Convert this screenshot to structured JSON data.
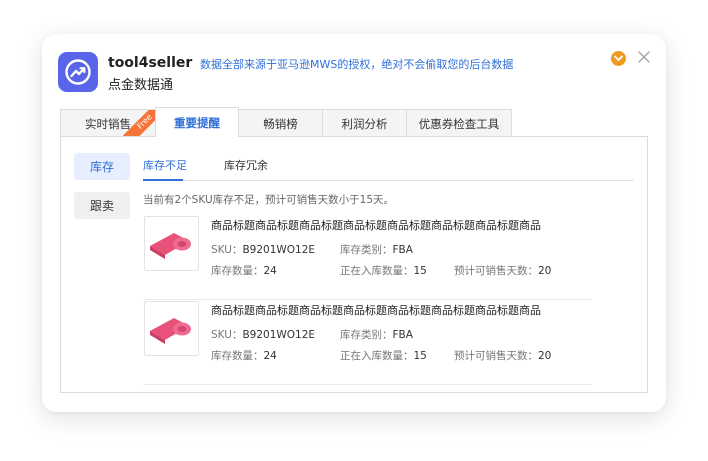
{
  "header": {
    "app_name": "tool4seller",
    "app_subtitle": "点金数据通",
    "notice": "数据全部来源于亚马逊MWS的授权，绝对不会偷取您的后台数据",
    "notify_icon": "notify-icon",
    "close_icon": "close-icon"
  },
  "tabs": [
    {
      "label": "实时销售",
      "badge": "Free"
    },
    {
      "label": "重要提醒",
      "active": true
    },
    {
      "label": "畅销榜"
    },
    {
      "label": "利润分析"
    },
    {
      "label": "优惠券检查工具"
    }
  ],
  "sidebar": {
    "items": [
      {
        "label": "库存",
        "active": true
      },
      {
        "label": "跟卖"
      }
    ]
  },
  "subtabs": [
    {
      "label": "库存不足",
      "active": true
    },
    {
      "label": "库存冗余"
    }
  ],
  "summary": "当前有2个SKU库存不足，预计可销售天数小于15天。",
  "items": [
    {
      "title": "商品标题商品标题商品标题商品标题商品标题商品标题商品标题商品",
      "sku_label": "SKU：",
      "sku": "B9201WO12E",
      "type_label": "库存类别：",
      "type": "FBA",
      "stock_label": "库存数量：",
      "stock": "24",
      "inbound_label": "正在入库数量：",
      "inbound": "15",
      "days_label": "预计可销售天数：",
      "days": "20"
    },
    {
      "title": "商品标题商品标题商品标题商品标题商品标题商品标题商品标题商品",
      "sku_label": "SKU：",
      "sku": "B9201WO12E",
      "type_label": "库存类别：",
      "type": "FBA",
      "stock_label": "库存数量：",
      "stock": "24",
      "inbound_label": "正在入库数量：",
      "inbound": "15",
      "days_label": "预计可销售天数：",
      "days": "20"
    }
  ],
  "colors": {
    "accent": "#2f6fd7",
    "logo": "#5865e8",
    "badge": "#f5743a",
    "notify": "#f09a22",
    "product": "#e8517a"
  }
}
